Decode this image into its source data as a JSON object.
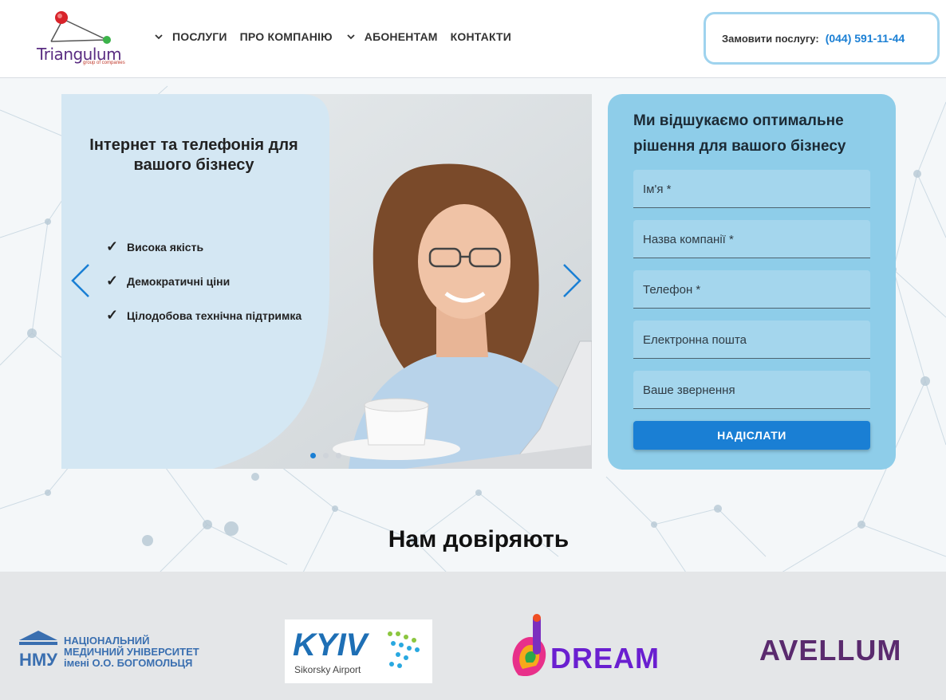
{
  "header": {
    "logo_text": "Triangulum",
    "logo_sub": "group of companies",
    "nav": [
      {
        "label": "ПОСЛУГИ",
        "has_dropdown": true
      },
      {
        "label": "ПРО КОМПАНІЮ",
        "has_dropdown": false
      },
      {
        "label": "АБОНЕНТАМ",
        "has_dropdown": true
      },
      {
        "label": "КОНТАКТИ",
        "has_dropdown": false
      }
    ],
    "cta_label": "Замовити послугу:",
    "cta_phone": "(044) 591-11-44"
  },
  "slider": {
    "title": "Інтернет та телефонія для вашого бізнесу",
    "features": [
      "Висока якість",
      "Демократичні ціни",
      "Цілодобова технічна підтримка"
    ],
    "check_glyph": "✓",
    "dots": 3,
    "active_dot": 0
  },
  "form": {
    "title": "Ми відшукаємо оптимальне рішення для вашого бізнесу",
    "fields": [
      "Ім'я *",
      "Назва компанії *",
      "Телефон *",
      "Електронна пошта",
      "Ваше звернення"
    ],
    "submit_label": "НАДІСЛАТИ"
  },
  "trust": {
    "title": "Нам довіряють",
    "partners": [
      {
        "name": "НМУ",
        "lines": [
          "НАЦІОНАЛЬНИЙ",
          "МЕДИЧНИЙ УНІВЕРСИТЕТ",
          "імені О.О. БОГОМОЛЬЦЯ"
        ]
      },
      {
        "name": "KYIV",
        "sub": "Sikorsky Airport"
      },
      {
        "name": "DREAM"
      },
      {
        "name": "AVELLUM"
      }
    ]
  },
  "colors": {
    "accent": "#1a7fd4",
    "form_bg": "#8ecde9",
    "panel_bg": "#d4e7f3",
    "logo_purple": "#5a2d82"
  }
}
